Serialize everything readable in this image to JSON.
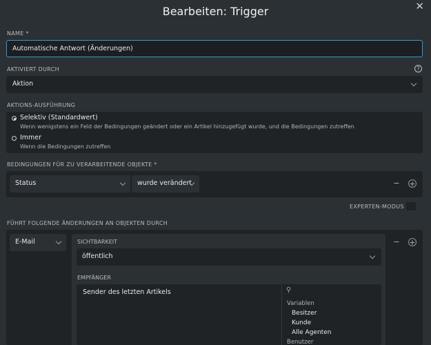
{
  "dialog": {
    "title": "Bearbeiten: Trigger",
    "close_icon": "close-icon"
  },
  "name": {
    "label": "NAME *",
    "value": "Automatische Antwort (Änderungen)"
  },
  "activated_by": {
    "label": "AKTIVIERT DURCH",
    "value": "Aktion",
    "help": "?"
  },
  "execution": {
    "label": "AKTIONS-AUSFÜHRUNG",
    "options": [
      {
        "title": "Selektiv (Standardwert)",
        "desc": "Wenn wenigstens ein Feld der Bedingungen geändert oder ein Artikel hinzugefügt wurde, und die Bedingungen zutreffen",
        "selected": true
      },
      {
        "title": "Immer",
        "desc": "Wenn die Bedingungen zutreffen",
        "selected": false
      }
    ]
  },
  "conditions": {
    "label": "BEDINGUNGEN FÜR ZU VERARBEITENDE OBJEKTE *",
    "attribute": "Status",
    "operator": "wurde verändert",
    "minus": "−",
    "plus": "+"
  },
  "expert_mode": {
    "label": "EXPERTEN-MODUS"
  },
  "actions": {
    "label": "FÜHRT FOLGENDE ÄNDERUNGEN AN OBJEKTEN DURCH",
    "type": "E-Mail",
    "visibility_label": "SICHTBARKEIT",
    "visibility_value": "öffentlich",
    "recipient_label": "EMPFÄNGER",
    "recipient_selected": "Sender des letzten Artikels",
    "picker": {
      "group1": "Variablen",
      "items": [
        "Besitzer",
        "Kunde",
        "Alle Agenten"
      ],
      "group2": "Benutzer"
    },
    "minus": "−",
    "plus": "+"
  }
}
